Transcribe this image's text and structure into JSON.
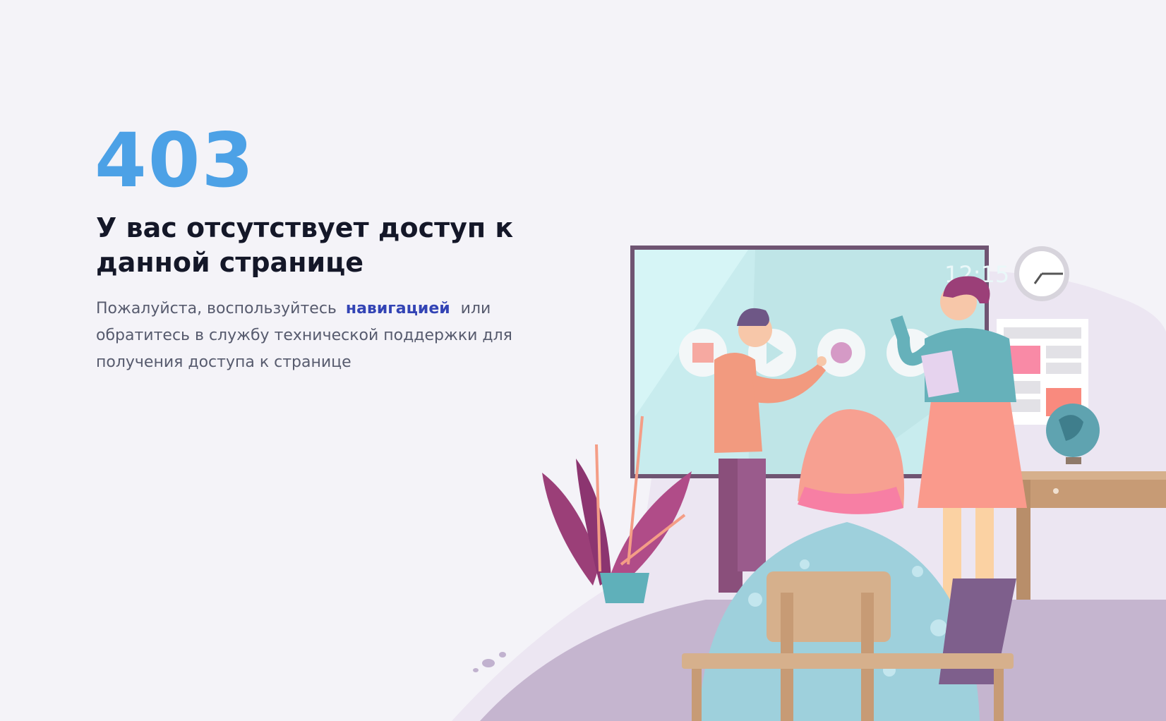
{
  "error": {
    "code": "403",
    "title": "У вас отсутствует доступ к данной странице",
    "description_before": "Пожалуйста, воспользуйтесь",
    "navigation_link": "навигацией",
    "description_after": "или обратитесь в службу технической поддержки для получения доступа к странице"
  },
  "illustration": {
    "screen_time": "12:15"
  },
  "colors": {
    "accent": "#4ca1e6",
    "link": "#3344b5",
    "title": "#141728",
    "text": "#575b6e",
    "background": "#f4f3f8"
  }
}
